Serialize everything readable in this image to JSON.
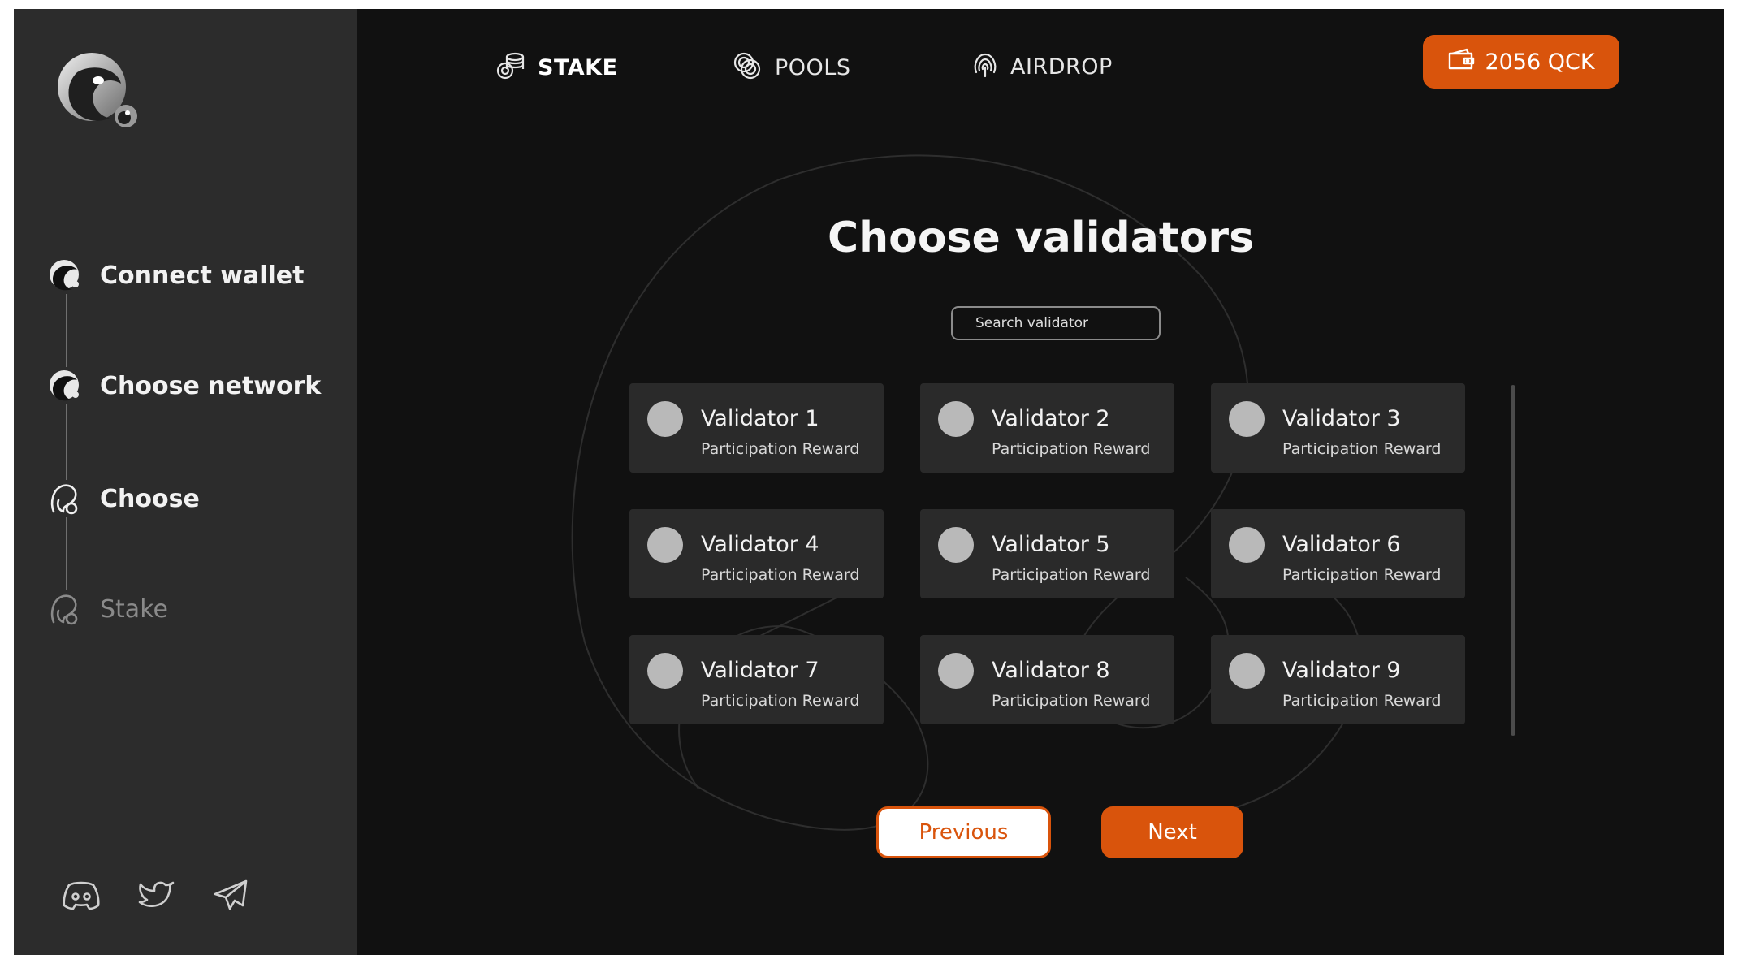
{
  "colors": {
    "accent": "#d9540c",
    "sidebar_bg": "#2c2c2c",
    "main_bg": "#111111",
    "card_bg": "#2a2a2a"
  },
  "sidebar": {
    "logo_icon": "app-logo",
    "steps": [
      {
        "label": "Connect wallet",
        "icon": "step-done-icon"
      },
      {
        "label": "Choose network",
        "icon": "step-done-icon"
      },
      {
        "label": "Choose",
        "icon": "step-current-icon"
      },
      {
        "label": "Stake",
        "icon": "step-pending-icon"
      }
    ],
    "socials": [
      "discord-icon",
      "twitter-icon",
      "telegram-icon"
    ]
  },
  "header": {
    "nav": [
      {
        "label": "STAKE",
        "icon": "stake-coins-icon",
        "active": true
      },
      {
        "label": "POOLS",
        "icon": "pools-icon",
        "active": false
      },
      {
        "label": "AIRDROP",
        "icon": "airdrop-icon",
        "active": false
      }
    ],
    "balance": "2056 QCK",
    "balance_icon": "wallet-icon"
  },
  "main": {
    "title": "Choose validators",
    "search_placeholder": "Search validator",
    "validators": [
      {
        "name": "Validator 1",
        "subtitle": "Participation Reward"
      },
      {
        "name": "Validator 2",
        "subtitle": "Participation Reward"
      },
      {
        "name": "Validator 3",
        "subtitle": "Participation Reward"
      },
      {
        "name": "Validator 4",
        "subtitle": "Participation Reward"
      },
      {
        "name": "Validator 5",
        "subtitle": "Participation Reward"
      },
      {
        "name": "Validator 6",
        "subtitle": "Participation Reward"
      },
      {
        "name": "Validator 7",
        "subtitle": "Participation Reward"
      },
      {
        "name": "Validator 8",
        "subtitle": "Participation Reward"
      },
      {
        "name": "Validator 9",
        "subtitle": "Participation Reward"
      }
    ],
    "prev_label": "Previous",
    "next_label": "Next"
  }
}
